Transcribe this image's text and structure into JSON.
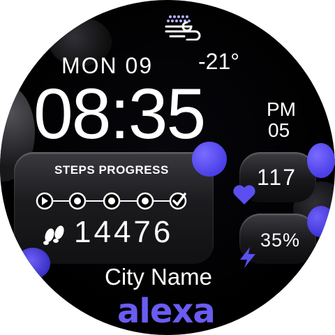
{
  "date": {
    "day_name": "MON",
    "day_number": "09"
  },
  "weather": {
    "icon": "wind-icon",
    "temperature": "-21°"
  },
  "time": {
    "hours_minutes": "08:35",
    "ampm": "PM",
    "seconds": "05"
  },
  "steps": {
    "title": "STEPS PROGRESS",
    "value": "14476",
    "progress_icons": [
      "play-icon",
      "dot-icon",
      "dot-icon",
      "dot-icon",
      "dot-icon",
      "check-icon"
    ],
    "icon": "footprints-icon"
  },
  "heart_rate": {
    "value": "117",
    "icon": "heart-icon"
  },
  "battery": {
    "value": "35%",
    "icon": "bolt-icon"
  },
  "city": "City Name",
  "brand": "alexa",
  "colors": {
    "accent": "#6a5cf2",
    "text": "#ffffff",
    "background": "#000000"
  }
}
